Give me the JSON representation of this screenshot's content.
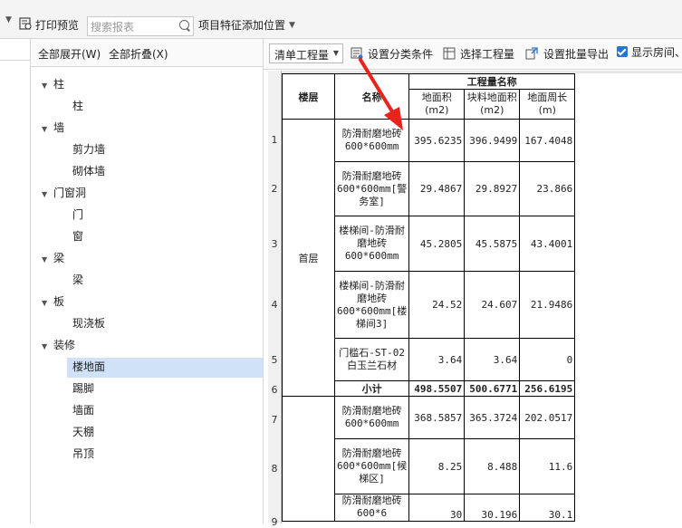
{
  "toolbar": {
    "print_preview": "打印预览",
    "search_placeholder": "搜索报表",
    "add_position": "项目特征添加位置"
  },
  "tree_panel": {
    "expand_all": "全部展开(W)",
    "collapse_all": "全部折叠(X)",
    "groups": [
      {
        "label": "柱",
        "children": [
          "柱"
        ]
      },
      {
        "label": "墙",
        "children": [
          "剪力墙",
          "砌体墙"
        ]
      },
      {
        "label": "门窗洞",
        "children": [
          "门",
          "窗"
        ]
      },
      {
        "label": "梁",
        "children": [
          "梁"
        ]
      },
      {
        "label": "板",
        "children": [
          "现浇板"
        ]
      },
      {
        "label": "装修",
        "children": [
          "楼地面",
          "踢脚",
          "墙面",
          "天棚",
          "吊顶"
        ]
      }
    ],
    "selected": "楼地面"
  },
  "main_toolbar": {
    "quantity_combo": "清单工程量",
    "set_category": "设置分类条件",
    "select_quantity": "选择工程量",
    "batch_export": "设置批量导出",
    "show_rooms": "显示房间、"
  },
  "table": {
    "headers": {
      "floor": "楼层",
      "name": "名称",
      "group": "工程量名称",
      "area": "地面积(m2)",
      "block_area": "块料地面积(m2)",
      "perimeter": "地面周长(m)"
    },
    "row_numbers": [
      "1",
      "2",
      "3",
      "4",
      "5",
      "6",
      "7",
      "8",
      "9"
    ],
    "floor_first": "首层",
    "rows": [
      {
        "name": "防滑耐磨地砖600*600mm",
        "area": "395.6235",
        "block": "396.9499",
        "perim": "167.4048"
      },
      {
        "name": "防滑耐磨地砖600*600mm[警务室]",
        "area": "29.4867",
        "block": "29.8927",
        "perim": "23.866"
      },
      {
        "name": "楼梯间-防滑耐磨地砖600*600mm",
        "area": "45.2805",
        "block": "45.5875",
        "perim": "43.4001"
      },
      {
        "name": "楼梯间-防滑耐磨地砖600*600mm[楼梯间3]",
        "area": "24.52",
        "block": "24.607",
        "perim": "21.9486"
      },
      {
        "name": "门槛石-ST-02白玉兰石材",
        "area": "3.64",
        "block": "3.64",
        "perim": "0"
      },
      {
        "name": "小计",
        "area": "498.5507",
        "block": "500.6771",
        "perim": "256.6195"
      },
      {
        "name": "防滑耐磨地砖600*600mm",
        "area": "368.5857",
        "block": "365.3724",
        "perim": "202.0517"
      },
      {
        "name": "防滑耐磨地砖600*600mm[候梯区]",
        "area": "8.25",
        "block": "8.488",
        "perim": "11.6"
      },
      {
        "name": "防滑耐磨地砖600*6",
        "area": "30",
        "block": "30.196",
        "perim": "30.1"
      }
    ]
  },
  "colors": {
    "accent": "#2a72d6",
    "selection": "#cfe2f7",
    "arrow": "#e8231b"
  }
}
